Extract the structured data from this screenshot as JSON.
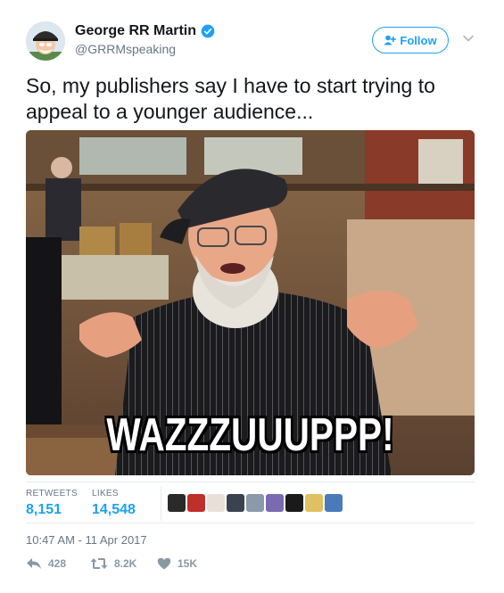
{
  "header": {
    "name": "George RR Martin",
    "handle": "@GRRMspeaking",
    "follow_label": "Follow"
  },
  "tweet": {
    "text": "So, my publishers say I have to start trying to appeal to a younger audience...",
    "media_caption": "WAZZZUUUPPP!",
    "timestamp": "10:47 AM - 11 Apr 2017"
  },
  "stats": {
    "retweets_label": "RETWEETS",
    "retweets_value": "8,151",
    "likes_label": "LIKES",
    "likes_value": "14,548"
  },
  "actions": {
    "reply_count": "428",
    "retweet_count": "8.2K",
    "like_count": "15K"
  },
  "colors": {
    "accent": "#1da1f2",
    "muted": "#657786",
    "action_gray": "#8899a6",
    "divider": "#e6ecf0"
  },
  "liker_avatar_colors": [
    "#2a2a2a",
    "#c0302a",
    "#e8e0d8",
    "#3a4250",
    "#8a9aa8",
    "#7a6ab0",
    "#1a1a1a",
    "#e0c060",
    "#4a7ab8"
  ]
}
